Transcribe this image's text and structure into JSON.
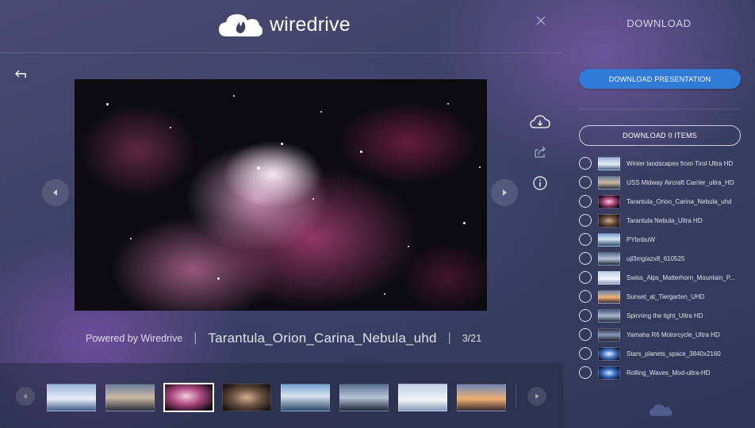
{
  "brand": {
    "name": "wiredrive"
  },
  "viewer": {
    "powered_by": "Powered by Wiredrive",
    "separator": "|",
    "filename": "Tarantula_Orion_Carina_Nebula_uhd",
    "counter": "3/21"
  },
  "panel": {
    "title": "DOWNLOAD",
    "download_presentation": "DOWNLOAD PRESENTATION",
    "download_items": "DOWNLOAD 0 ITEMS",
    "items": [
      {
        "label": "Winter landscapes from Tirol Ultra HD"
      },
      {
        "label": "USS Midway Aircraft Carrier_ultra_HD"
      },
      {
        "label": "Tarantula_Orion_Carina_Nebula_uhd"
      },
      {
        "label": "Tarantula Nebula_Ultra HD"
      },
      {
        "label": "PYbnbuW"
      },
      {
        "label": "ujl3mgiazx8_610525"
      },
      {
        "label": "Swiss_Alps_Matterhorn_Mountain_P..."
      },
      {
        "label": "Sunset_at_Tiergarten_UHD"
      },
      {
        "label": "Spinning the light_Ultra HD"
      },
      {
        "label": "Yamaha R6 Motorcycle_Ultra HD"
      },
      {
        "label": "Stars_planets_space_3840x2160"
      },
      {
        "label": "Rolling_Waves_Mod-ultra-HD"
      }
    ]
  },
  "filmstrip": {
    "active_index": 2,
    "thumb_count": 8
  },
  "colors": {
    "accent": "#2f7ad6",
    "background": "#3a3d5e"
  },
  "icons": {
    "logo": "cloud-flame-icon",
    "close": "close-icon",
    "back": "back-arrow-icon",
    "prev": "chevron-left-icon",
    "next": "chevron-right-icon",
    "download": "cloud-download-icon",
    "share": "share-icon",
    "info": "info-icon"
  }
}
